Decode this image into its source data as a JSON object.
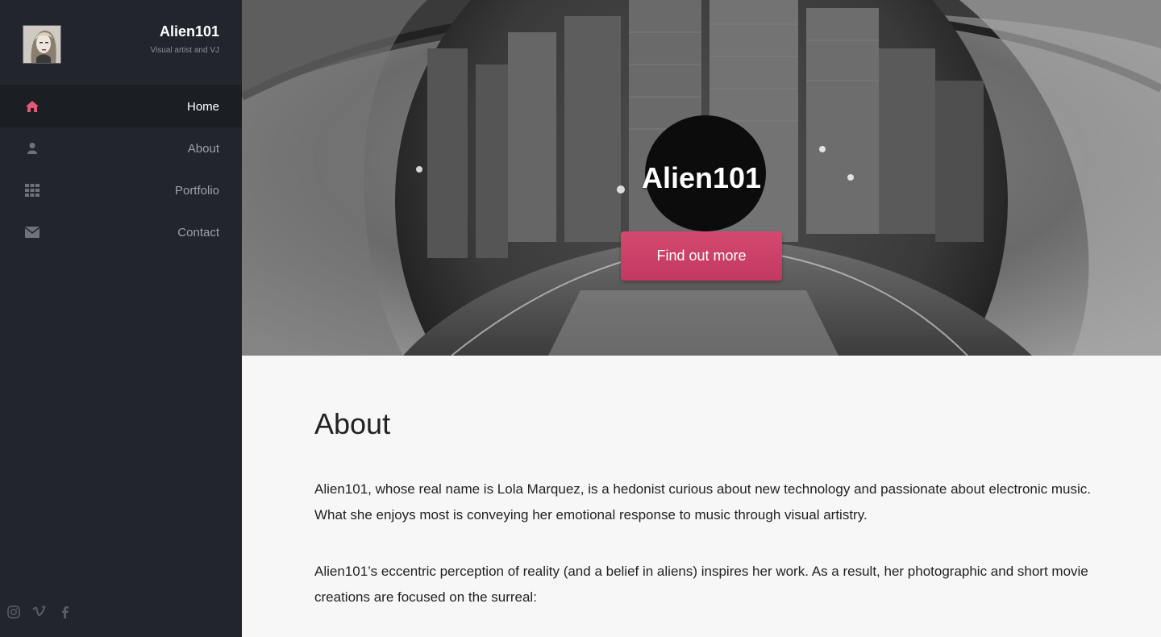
{
  "sidebar": {
    "site_name": "Alien101",
    "tagline": "Visual artist and VJ",
    "nav": [
      {
        "label": "Home",
        "icon": "home-icon",
        "active": true
      },
      {
        "label": "About",
        "icon": "user-icon",
        "active": false
      },
      {
        "label": "Portfolio",
        "icon": "grid-icon",
        "active": false
      },
      {
        "label": "Contact",
        "icon": "envelope-icon",
        "active": false
      }
    ],
    "social": [
      "instagram-icon",
      "vimeo-icon",
      "facebook-icon"
    ]
  },
  "hero": {
    "title": "Alien101",
    "button_label": "Find out more"
  },
  "about": {
    "heading": "About",
    "paragraph1": "Alien101, whose real name is Lola Marquez, is a hedonist curious about new technology and passionate about electronic music. What she enjoys most is conveying her emotional response to music through visual artistry.",
    "paragraph2": "Alien101’s eccentric perception of reality (and a belief in aliens) inspires her work. As a result, her photographic and short movie creations are focused on the surreal:"
  },
  "colors": {
    "sidebar_bg": "#22262c",
    "accent": "#d5496f",
    "active_icon": "#e05a78"
  }
}
